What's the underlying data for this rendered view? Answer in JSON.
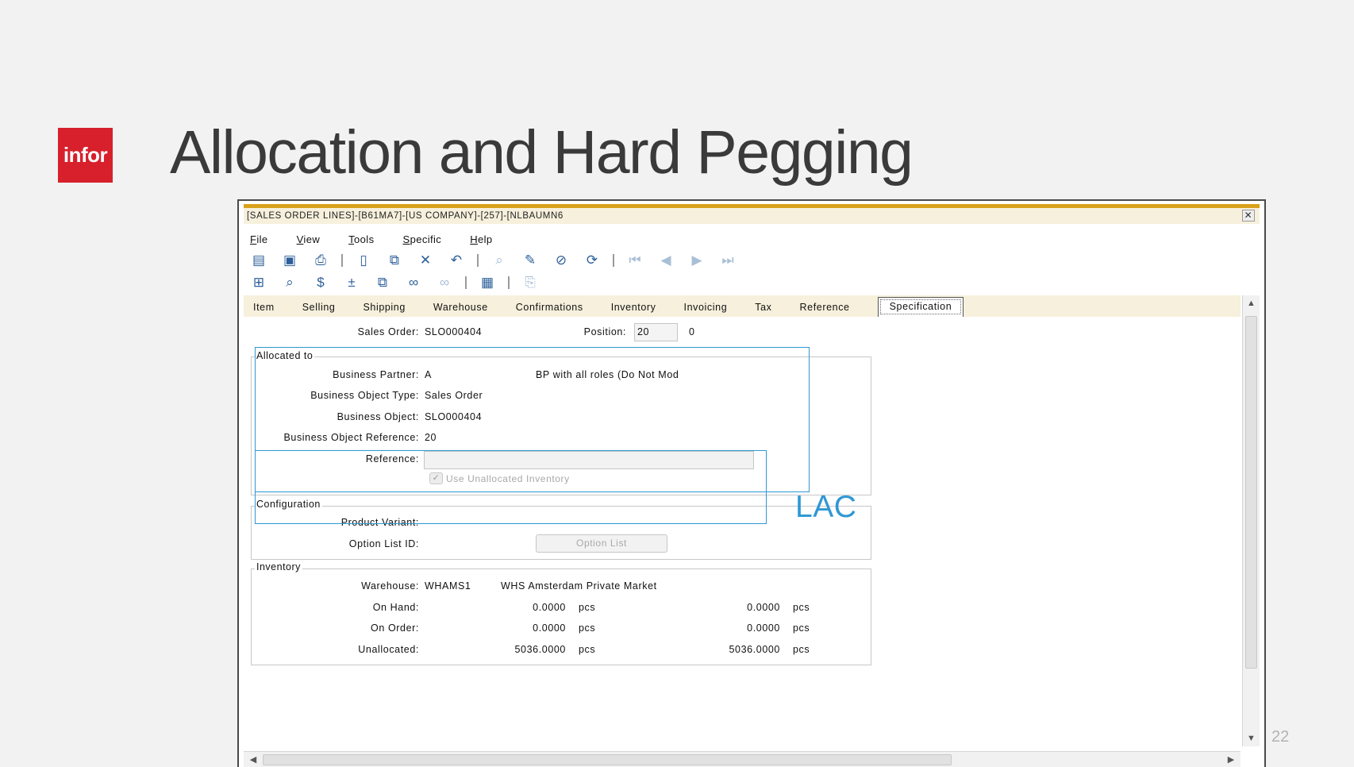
{
  "slide": {
    "logo_text": "infor",
    "title": "Allocation and Hard Pegging",
    "page_number": "22",
    "annotation_label": "LAC",
    "annotation_color": "#2f98d4"
  },
  "window": {
    "title": "[SALES ORDER LINES]-[B61MA7]-[US COMPANY]-[257]-[NLBAUMN6",
    "close_glyph": "✕",
    "menu": [
      {
        "key": "F",
        "rest": "ile"
      },
      {
        "key": "V",
        "rest": "iew"
      },
      {
        "key": "T",
        "rest": "ools"
      },
      {
        "key": "S",
        "rest": "pecific"
      },
      {
        "key": "H",
        "rest": "elp"
      }
    ],
    "tabs": [
      "Item",
      "Selling",
      "Shipping",
      "Warehouse",
      "Confirmations",
      "Inventory",
      "Invoicing",
      "Tax",
      "Reference",
      "Specification"
    ],
    "active_tab": "Specification"
  },
  "header": {
    "sales_order_label": "Sales Order:",
    "sales_order_value": "SLO000404",
    "position_label": "Position:",
    "position_value": "20",
    "position_seq": "0"
  },
  "allocated_to": {
    "title": "Allocated to",
    "business_partner_label": "Business Partner:",
    "business_partner_value": "A",
    "business_partner_desc": "BP with all roles (Do Not Mod",
    "bo_type_label": "Business Object Type:",
    "bo_type_value": "Sales Order",
    "bo_label": "Business Object:",
    "bo_value": "SLO000404",
    "bo_ref_label": "Business Object Reference:",
    "bo_ref_value": "20",
    "reference_label": "Reference:",
    "reference_value": "",
    "use_unallocated_label": "Use Unallocated Inventory",
    "use_unallocated_checked": true
  },
  "configuration": {
    "title": "Configuration",
    "product_variant_label": "Product Variant:",
    "option_list_id_label": "Option List ID:",
    "option_list_button": "Option List"
  },
  "inventory": {
    "title": "Inventory",
    "warehouse_label": "Warehouse:",
    "warehouse_value": "WHAMS1",
    "warehouse_desc": "WHS Amsterdam Private Market",
    "rows": [
      {
        "label": "On Hand:",
        "qty1": "0.0000",
        "unit1": "pcs",
        "qty2": "0.0000",
        "unit2": "pcs"
      },
      {
        "label": "On Order:",
        "qty1": "0.0000",
        "unit1": "pcs",
        "qty2": "0.0000",
        "unit2": "pcs"
      },
      {
        "label": "Unallocated:",
        "qty1": "5036.0000",
        "unit1": "pcs",
        "qty2": "5036.0000",
        "unit2": "pcs"
      }
    ]
  },
  "colors": {
    "brand_red": "#d7202b",
    "title_bar_gold": "#d9a21a",
    "tab_bar": "#f6f0dc"
  }
}
